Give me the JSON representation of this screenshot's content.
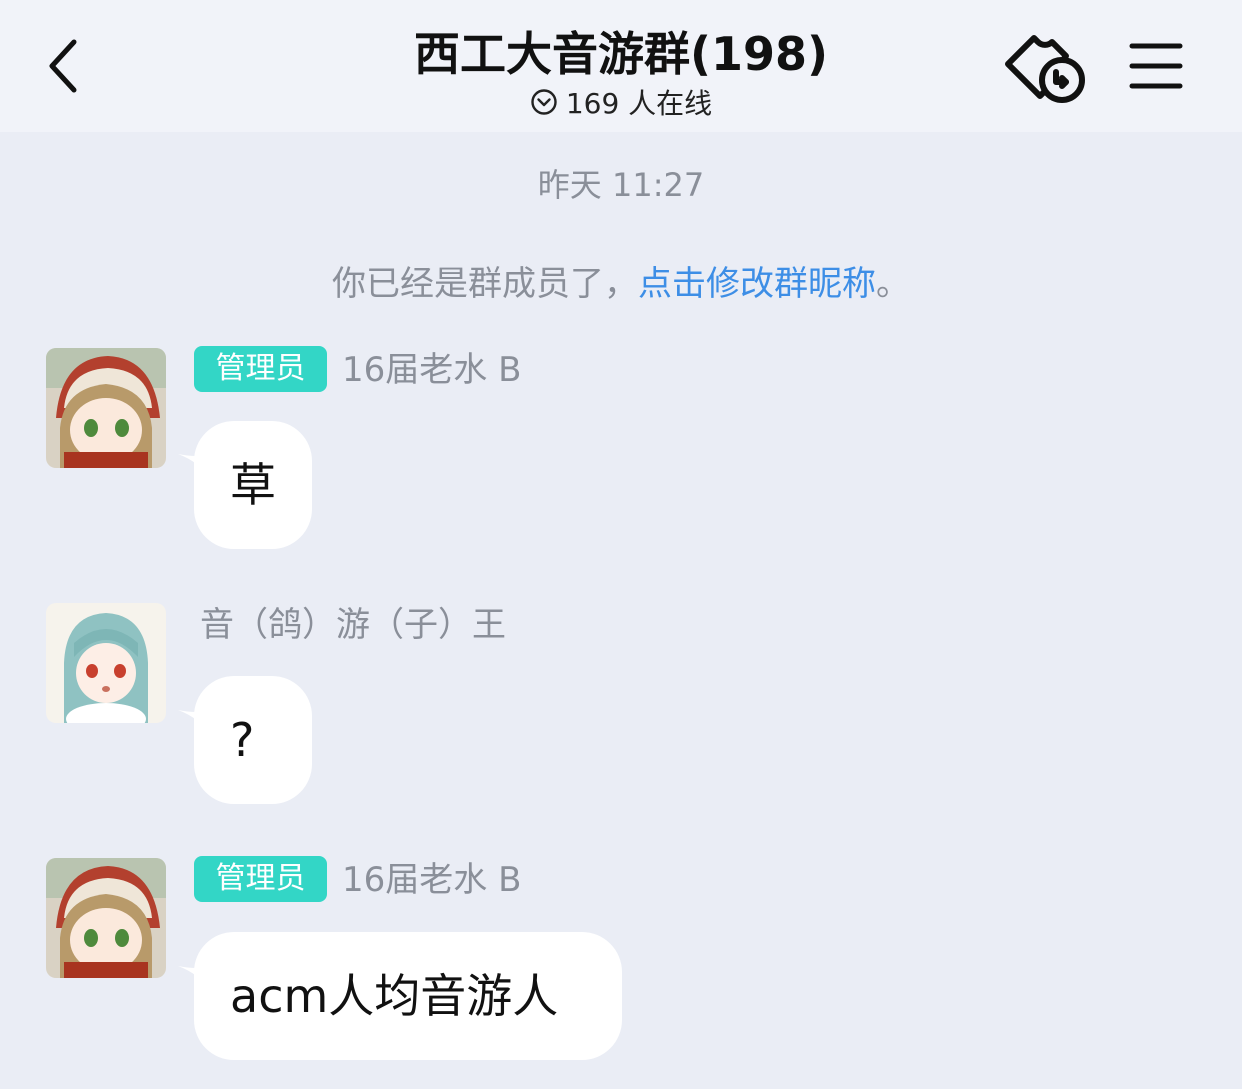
{
  "header": {
    "title": "西工大音游群(198)",
    "online": "169 人在线",
    "back_icon": "chevron-left-icon",
    "ticket_icon": "ticket-icon",
    "menu_icon": "hamburger-icon"
  },
  "chat": {
    "timestamp": "昨天 11:27",
    "system_message": {
      "text": "你已经是群成员了，",
      "link": "点击修改群昵称",
      "suffix": "。"
    },
    "messages": [
      {
        "badge": "管理员",
        "sender": "16届老水 B",
        "text": "草"
      },
      {
        "badge": "",
        "sender": "音（鸽）游（子）王",
        "text": "?"
      },
      {
        "badge": "管理员",
        "sender": "16届老水 B",
        "text": "acm人均音游人"
      }
    ]
  },
  "colors": {
    "background": "#eaedf5",
    "header": "#f1f3f9",
    "badge": "#33d6c6",
    "link": "#3d8ee6",
    "muted": "#8a8f99"
  }
}
